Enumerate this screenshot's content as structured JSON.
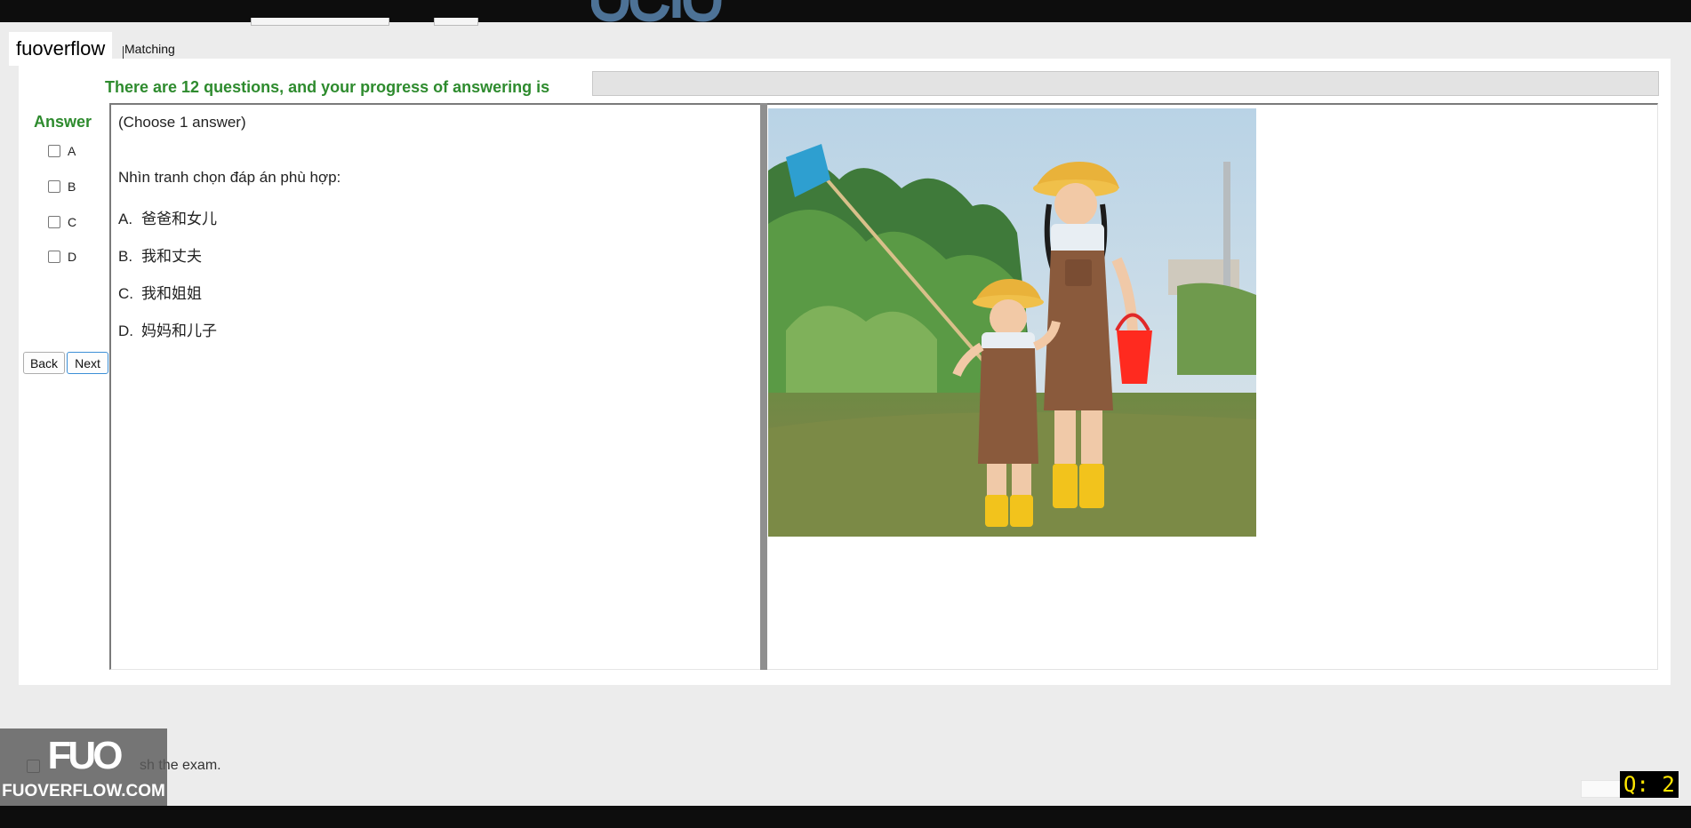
{
  "brand_label": "fuoverflow",
  "tab_label": "Matching",
  "progress": {
    "text": "There are 12 questions, and your progress of answering is",
    "fraction": 0
  },
  "answer": {
    "title": "Answer",
    "options": [
      "A",
      "B",
      "C",
      "D"
    ]
  },
  "nav": {
    "back_label": "Back",
    "next_label": "Next"
  },
  "question": {
    "hint": "(Choose 1 answer)",
    "prompt": "Nhìn tranh chọn đáp án phù hợp:",
    "choices": [
      {
        "letter": "A.",
        "text": "爸爸和女儿"
      },
      {
        "letter": "B.",
        "text": "我和丈夫"
      },
      {
        "letter": "C.",
        "text": "我和姐姐"
      },
      {
        "letter": "D.",
        "text": "妈妈和儿子"
      }
    ]
  },
  "finish": {
    "label_visible": "sh the exam."
  },
  "watermark": {
    "main": "FUO",
    "sub": "FUOVERFLOW.COM"
  },
  "counter": "Q: 2",
  "colors": {
    "accent_green": "#2e8b2e",
    "panel_border": "#7a7a7a",
    "counter_text": "#ffe600"
  }
}
